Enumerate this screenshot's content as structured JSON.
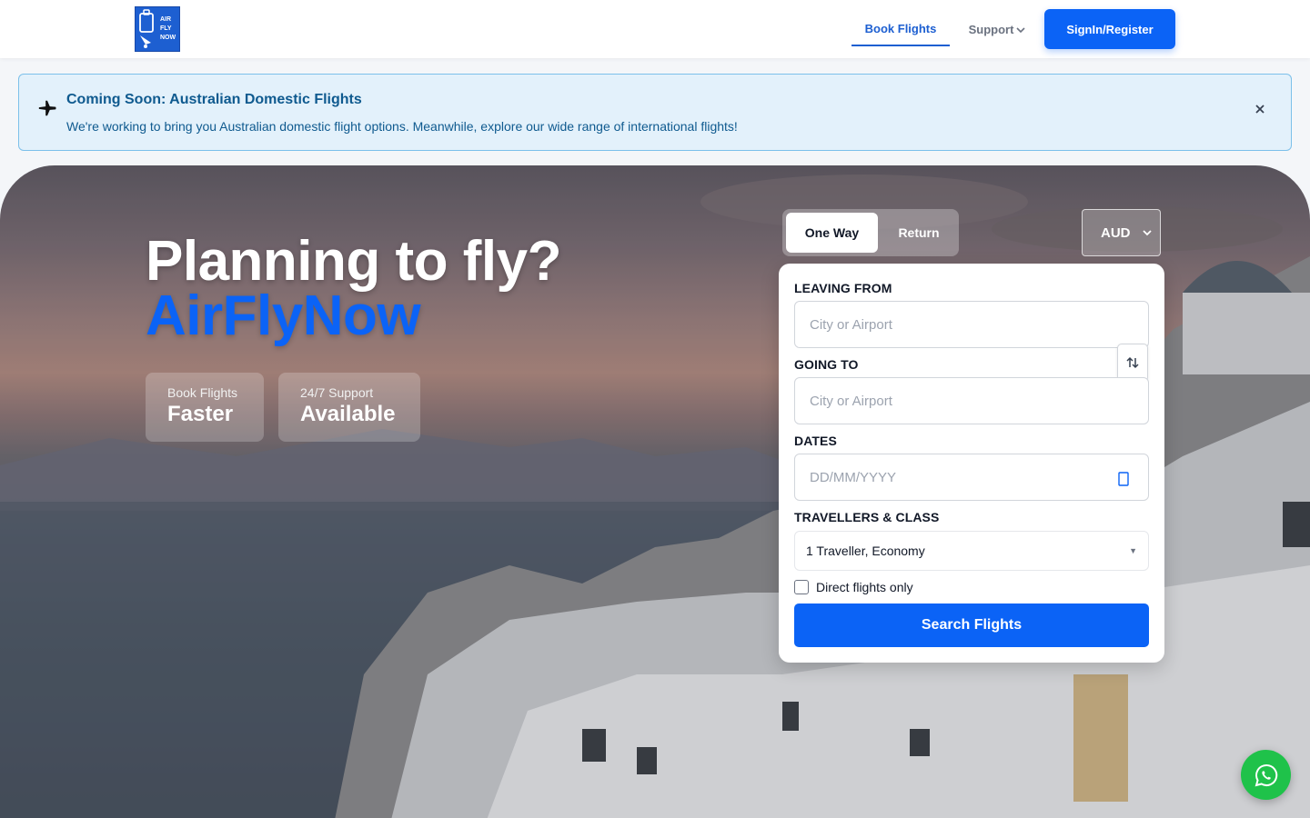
{
  "header": {
    "logo_text": "AIR FLY NOW",
    "nav_book": "Book Flights",
    "nav_support": "Support",
    "signin": "SignIn/Register"
  },
  "banner": {
    "icon": "airplane-icon",
    "title": "Coming Soon: Australian Domestic Flights",
    "text": "We're working to bring you Australian domestic flight options. Meanwhile, explore our wide range of international flights!",
    "close_icon": "close-icon"
  },
  "hero": {
    "title": "Planning to fly?",
    "brand": "AirFlyNow",
    "stats": [
      {
        "small": "Book Flights",
        "big": "Faster"
      },
      {
        "small": "24/7 Support",
        "big": "Available"
      }
    ]
  },
  "search": {
    "trip_oneway": "One Way",
    "trip_return": "Return",
    "currency": "AUD",
    "leaving_label": "Leaving From",
    "leaving_placeholder": "City or Airport",
    "going_label": "Going To",
    "going_placeholder": "City or Airport",
    "dates_label": "Dates",
    "dates_placeholder": "DD/MM/YYYY",
    "travellers_label": "Travellers & Class",
    "travellers_value": "1 Traveller, Economy",
    "direct_label": "Direct flights only",
    "direct_checked": false,
    "submit": "Search Flights"
  },
  "colors": {
    "primary": "#0b63f6",
    "banner_bg": "#e3f1fb",
    "banner_text": "#0f5a8f",
    "whatsapp": "#1fc24a"
  }
}
